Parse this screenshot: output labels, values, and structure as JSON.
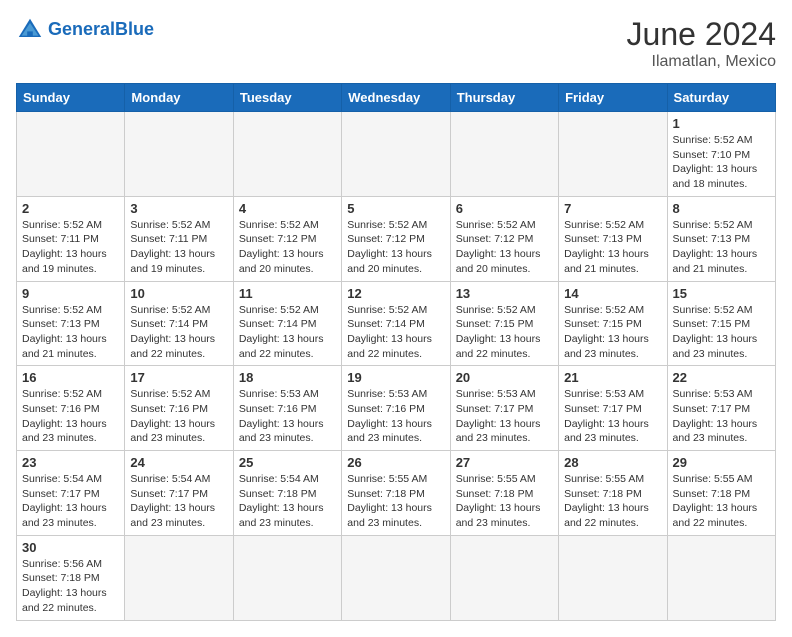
{
  "header": {
    "logo_general": "General",
    "logo_blue": "Blue",
    "month_year": "June 2024",
    "location": "Ilamatlan, Mexico"
  },
  "days_of_week": [
    "Sunday",
    "Monday",
    "Tuesday",
    "Wednesday",
    "Thursday",
    "Friday",
    "Saturday"
  ],
  "weeks": [
    [
      {
        "day": "",
        "info": ""
      },
      {
        "day": "",
        "info": ""
      },
      {
        "day": "",
        "info": ""
      },
      {
        "day": "",
        "info": ""
      },
      {
        "day": "",
        "info": ""
      },
      {
        "day": "",
        "info": ""
      },
      {
        "day": "1",
        "info": "Sunrise: 5:52 AM\nSunset: 7:10 PM\nDaylight: 13 hours\nand 18 minutes."
      }
    ],
    [
      {
        "day": "2",
        "info": "Sunrise: 5:52 AM\nSunset: 7:11 PM\nDaylight: 13 hours\nand 19 minutes."
      },
      {
        "day": "3",
        "info": "Sunrise: 5:52 AM\nSunset: 7:11 PM\nDaylight: 13 hours\nand 19 minutes."
      },
      {
        "day": "4",
        "info": "Sunrise: 5:52 AM\nSunset: 7:12 PM\nDaylight: 13 hours\nand 20 minutes."
      },
      {
        "day": "5",
        "info": "Sunrise: 5:52 AM\nSunset: 7:12 PM\nDaylight: 13 hours\nand 20 minutes."
      },
      {
        "day": "6",
        "info": "Sunrise: 5:52 AM\nSunset: 7:12 PM\nDaylight: 13 hours\nand 20 minutes."
      },
      {
        "day": "7",
        "info": "Sunrise: 5:52 AM\nSunset: 7:13 PM\nDaylight: 13 hours\nand 21 minutes."
      },
      {
        "day": "8",
        "info": "Sunrise: 5:52 AM\nSunset: 7:13 PM\nDaylight: 13 hours\nand 21 minutes."
      }
    ],
    [
      {
        "day": "9",
        "info": "Sunrise: 5:52 AM\nSunset: 7:13 PM\nDaylight: 13 hours\nand 21 minutes."
      },
      {
        "day": "10",
        "info": "Sunrise: 5:52 AM\nSunset: 7:14 PM\nDaylight: 13 hours\nand 22 minutes."
      },
      {
        "day": "11",
        "info": "Sunrise: 5:52 AM\nSunset: 7:14 PM\nDaylight: 13 hours\nand 22 minutes."
      },
      {
        "day": "12",
        "info": "Sunrise: 5:52 AM\nSunset: 7:14 PM\nDaylight: 13 hours\nand 22 minutes."
      },
      {
        "day": "13",
        "info": "Sunrise: 5:52 AM\nSunset: 7:15 PM\nDaylight: 13 hours\nand 22 minutes."
      },
      {
        "day": "14",
        "info": "Sunrise: 5:52 AM\nSunset: 7:15 PM\nDaylight: 13 hours\nand 23 minutes."
      },
      {
        "day": "15",
        "info": "Sunrise: 5:52 AM\nSunset: 7:15 PM\nDaylight: 13 hours\nand 23 minutes."
      }
    ],
    [
      {
        "day": "16",
        "info": "Sunrise: 5:52 AM\nSunset: 7:16 PM\nDaylight: 13 hours\nand 23 minutes."
      },
      {
        "day": "17",
        "info": "Sunrise: 5:52 AM\nSunset: 7:16 PM\nDaylight: 13 hours\nand 23 minutes."
      },
      {
        "day": "18",
        "info": "Sunrise: 5:53 AM\nSunset: 7:16 PM\nDaylight: 13 hours\nand 23 minutes."
      },
      {
        "day": "19",
        "info": "Sunrise: 5:53 AM\nSunset: 7:16 PM\nDaylight: 13 hours\nand 23 minutes."
      },
      {
        "day": "20",
        "info": "Sunrise: 5:53 AM\nSunset: 7:17 PM\nDaylight: 13 hours\nand 23 minutes."
      },
      {
        "day": "21",
        "info": "Sunrise: 5:53 AM\nSunset: 7:17 PM\nDaylight: 13 hours\nand 23 minutes."
      },
      {
        "day": "22",
        "info": "Sunrise: 5:53 AM\nSunset: 7:17 PM\nDaylight: 13 hours\nand 23 minutes."
      }
    ],
    [
      {
        "day": "23",
        "info": "Sunrise: 5:54 AM\nSunset: 7:17 PM\nDaylight: 13 hours\nand 23 minutes."
      },
      {
        "day": "24",
        "info": "Sunrise: 5:54 AM\nSunset: 7:17 PM\nDaylight: 13 hours\nand 23 minutes."
      },
      {
        "day": "25",
        "info": "Sunrise: 5:54 AM\nSunset: 7:18 PM\nDaylight: 13 hours\nand 23 minutes."
      },
      {
        "day": "26",
        "info": "Sunrise: 5:55 AM\nSunset: 7:18 PM\nDaylight: 13 hours\nand 23 minutes."
      },
      {
        "day": "27",
        "info": "Sunrise: 5:55 AM\nSunset: 7:18 PM\nDaylight: 13 hours\nand 23 minutes."
      },
      {
        "day": "28",
        "info": "Sunrise: 5:55 AM\nSunset: 7:18 PM\nDaylight: 13 hours\nand 22 minutes."
      },
      {
        "day": "29",
        "info": "Sunrise: 5:55 AM\nSunset: 7:18 PM\nDaylight: 13 hours\nand 22 minutes."
      }
    ],
    [
      {
        "day": "30",
        "info": "Sunrise: 5:56 AM\nSunset: 7:18 PM\nDaylight: 13 hours\nand 22 minutes."
      },
      {
        "day": "",
        "info": ""
      },
      {
        "day": "",
        "info": ""
      },
      {
        "day": "",
        "info": ""
      },
      {
        "day": "",
        "info": ""
      },
      {
        "day": "",
        "info": ""
      },
      {
        "day": "",
        "info": ""
      }
    ]
  ]
}
